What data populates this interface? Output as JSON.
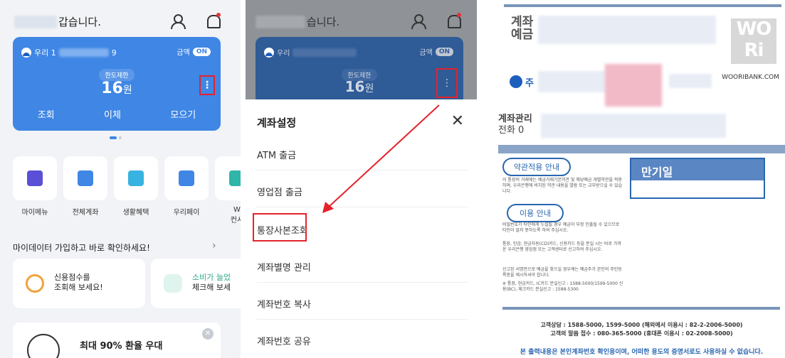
{
  "home": {
    "greeting_suffix": "갑습니다.",
    "card": {
      "bank_prefix": "우리 1",
      "account_tail": "9",
      "hide_amount_label": "금액",
      "hide_amount_state": "ON",
      "limit_tag": "한도제한",
      "amount": "16",
      "currency": "원",
      "actions": [
        "조회",
        "이체",
        "모으기"
      ]
    },
    "quick_menu": [
      "마이메뉴",
      "전체계좌",
      "생활혜택",
      "우리페이",
      "W\n컨시"
    ],
    "mydata_banner": "마이데이터 가입하고 바로 확인하세요!",
    "mini_cards": [
      {
        "line1": "신용점수를",
        "line2": "조회해 보세요!"
      },
      {
        "line1": "소비가 늘었",
        "line2": "체크해 보세"
      }
    ],
    "promo_title": "최대 90% 환율 우대"
  },
  "settings": {
    "greeting_suffix": "습니다.",
    "bank_prefix": "우리",
    "hide_amount_label": "금액",
    "hide_amount_state": "ON",
    "limit_tag": "한도제한",
    "amount": "16",
    "currency": "원",
    "sheet_title": "계좌설정",
    "items": [
      "ATM 출금",
      "영업점 출금",
      "통장사본조회",
      "계좌별명 관리",
      "계좌번호 복사",
      "계좌번호 공유"
    ]
  },
  "document": {
    "title_line1": "계좌",
    "title_line2": "예금",
    "watermark": "WO\nRi",
    "site": "WOORIBANK.COM",
    "bank_name": "주",
    "mgmt_line1": "계좌관리",
    "mgmt_line2": "전화  0",
    "terms_pill": "약관적용 안내",
    "terms_text": "이 통장의 거래에는 예금거래기본약관 및 해당예금 개별약관을 적용하며, 우리은행에 비치된 약관 내용을 열람 또는 교부받으실 수 있습니다.",
    "usage_pill": "이용 안내",
    "usage_text1": "비밀번호가 타인에게 누설될 경우 예금이 부정 인출될 수 있으므로 타인이 알지 못하도록 하여 주십시오.",
    "usage_text2": "통장, 인감, 현금자동(CD)카드, 신용카드 등을 분실 시는 바로 가까운 우리은행 영업점 또는 고객센터로 신고하여 주십시오.",
    "usage_text3": "신고된 서명만으로 예금을 찾으실 경우에는 예금주가 본인의 주민등록증을 제시하셔야 합니다.",
    "usage_text4": "※ 통장, 현금카드, IC카드 분실신고 : 1588-5000/1599-5000 신용(BC), 체크카드 분실신고 : 1588-5300",
    "maturity_label": "만기일",
    "contact1": "고객상담 : 1588-5000, 1599-5000 (해외에서 이용시 : 82-2-2006-5000)",
    "contact2": "고객의 말씀 접수 : 080-365-5000 (휴대폰 이용시 : 02-2008-5000)",
    "disclaimer": "본 출력내용은 본인계좌번호 확인용이며, 어떠한 용도의 증명서로도 사용하실 수 없습니다."
  },
  "colors": {
    "accent": "#3f86e5",
    "highlight": "#e5222c",
    "doc_blue": "#2a66b0"
  }
}
